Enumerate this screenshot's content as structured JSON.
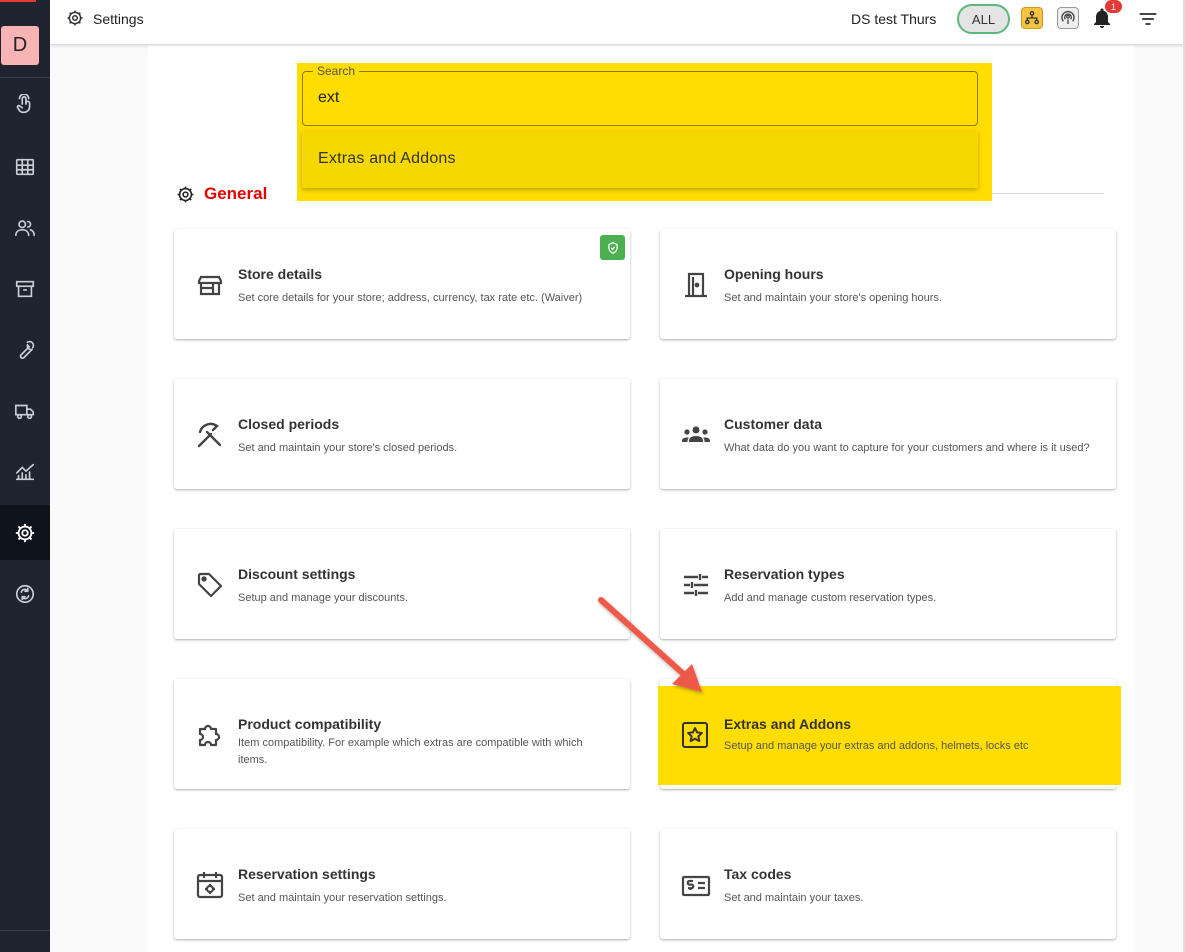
{
  "topbar": {
    "title": "Settings",
    "store_name": "DS test Thurs",
    "scope_label": "ALL",
    "notification_count": "1"
  },
  "sidebar": {
    "avatar_letter": "D",
    "items": [
      "touch-icon",
      "grid-icon",
      "users-icon",
      "archive-icon",
      "wrench-icon",
      "truck-icon",
      "analytics-icon",
      "gear-icon",
      "sync-icon"
    ],
    "active": "gear-icon"
  },
  "search": {
    "label": "Search",
    "value": "ext",
    "suggestion": "Extras and Addons"
  },
  "section": {
    "title": "General"
  },
  "cards": [
    {
      "title": "Store details",
      "desc": "Set core details for your store; address, currency, tax rate etc. (Waiver)",
      "icon": "store-icon"
    },
    {
      "title": "Opening hours",
      "desc": "Set and maintain your store's opening hours.",
      "icon": "door-icon"
    },
    {
      "title": "Closed periods",
      "desc": "Set and maintain your store's closed periods.",
      "icon": "beach-umbrella-off-icon"
    },
    {
      "title": "Customer data",
      "desc": "What data do you want to capture for your customers and where is it used?",
      "icon": "groups-icon"
    },
    {
      "title": "Discount settings",
      "desc": "Setup and manage your discounts.",
      "icon": "tag-icon"
    },
    {
      "title": "Reservation types",
      "desc": "Add and manage custom reservation types.",
      "icon": "tune-icon"
    },
    {
      "title": "Product compatibility",
      "desc": "Item compatibility. For example which extras are compatible with which items.",
      "icon": "puzzle-icon"
    },
    {
      "title": "Extras and Addons",
      "desc": "Setup and manage your extras and addons, helmets, locks etc",
      "icon": "star-box-icon"
    },
    {
      "title": "Reservation settings",
      "desc": "Set and maintain your reservation settings.",
      "icon": "calendar-gear-icon"
    },
    {
      "title": "Tax codes",
      "desc": "Set and maintain your taxes.",
      "icon": "tax-icon"
    }
  ],
  "colors": {
    "highlight": "#ffdd00",
    "section_title": "#e30000",
    "sidebar_bg": "#1f2430",
    "annotation_arrow": "#ee5a4a"
  }
}
